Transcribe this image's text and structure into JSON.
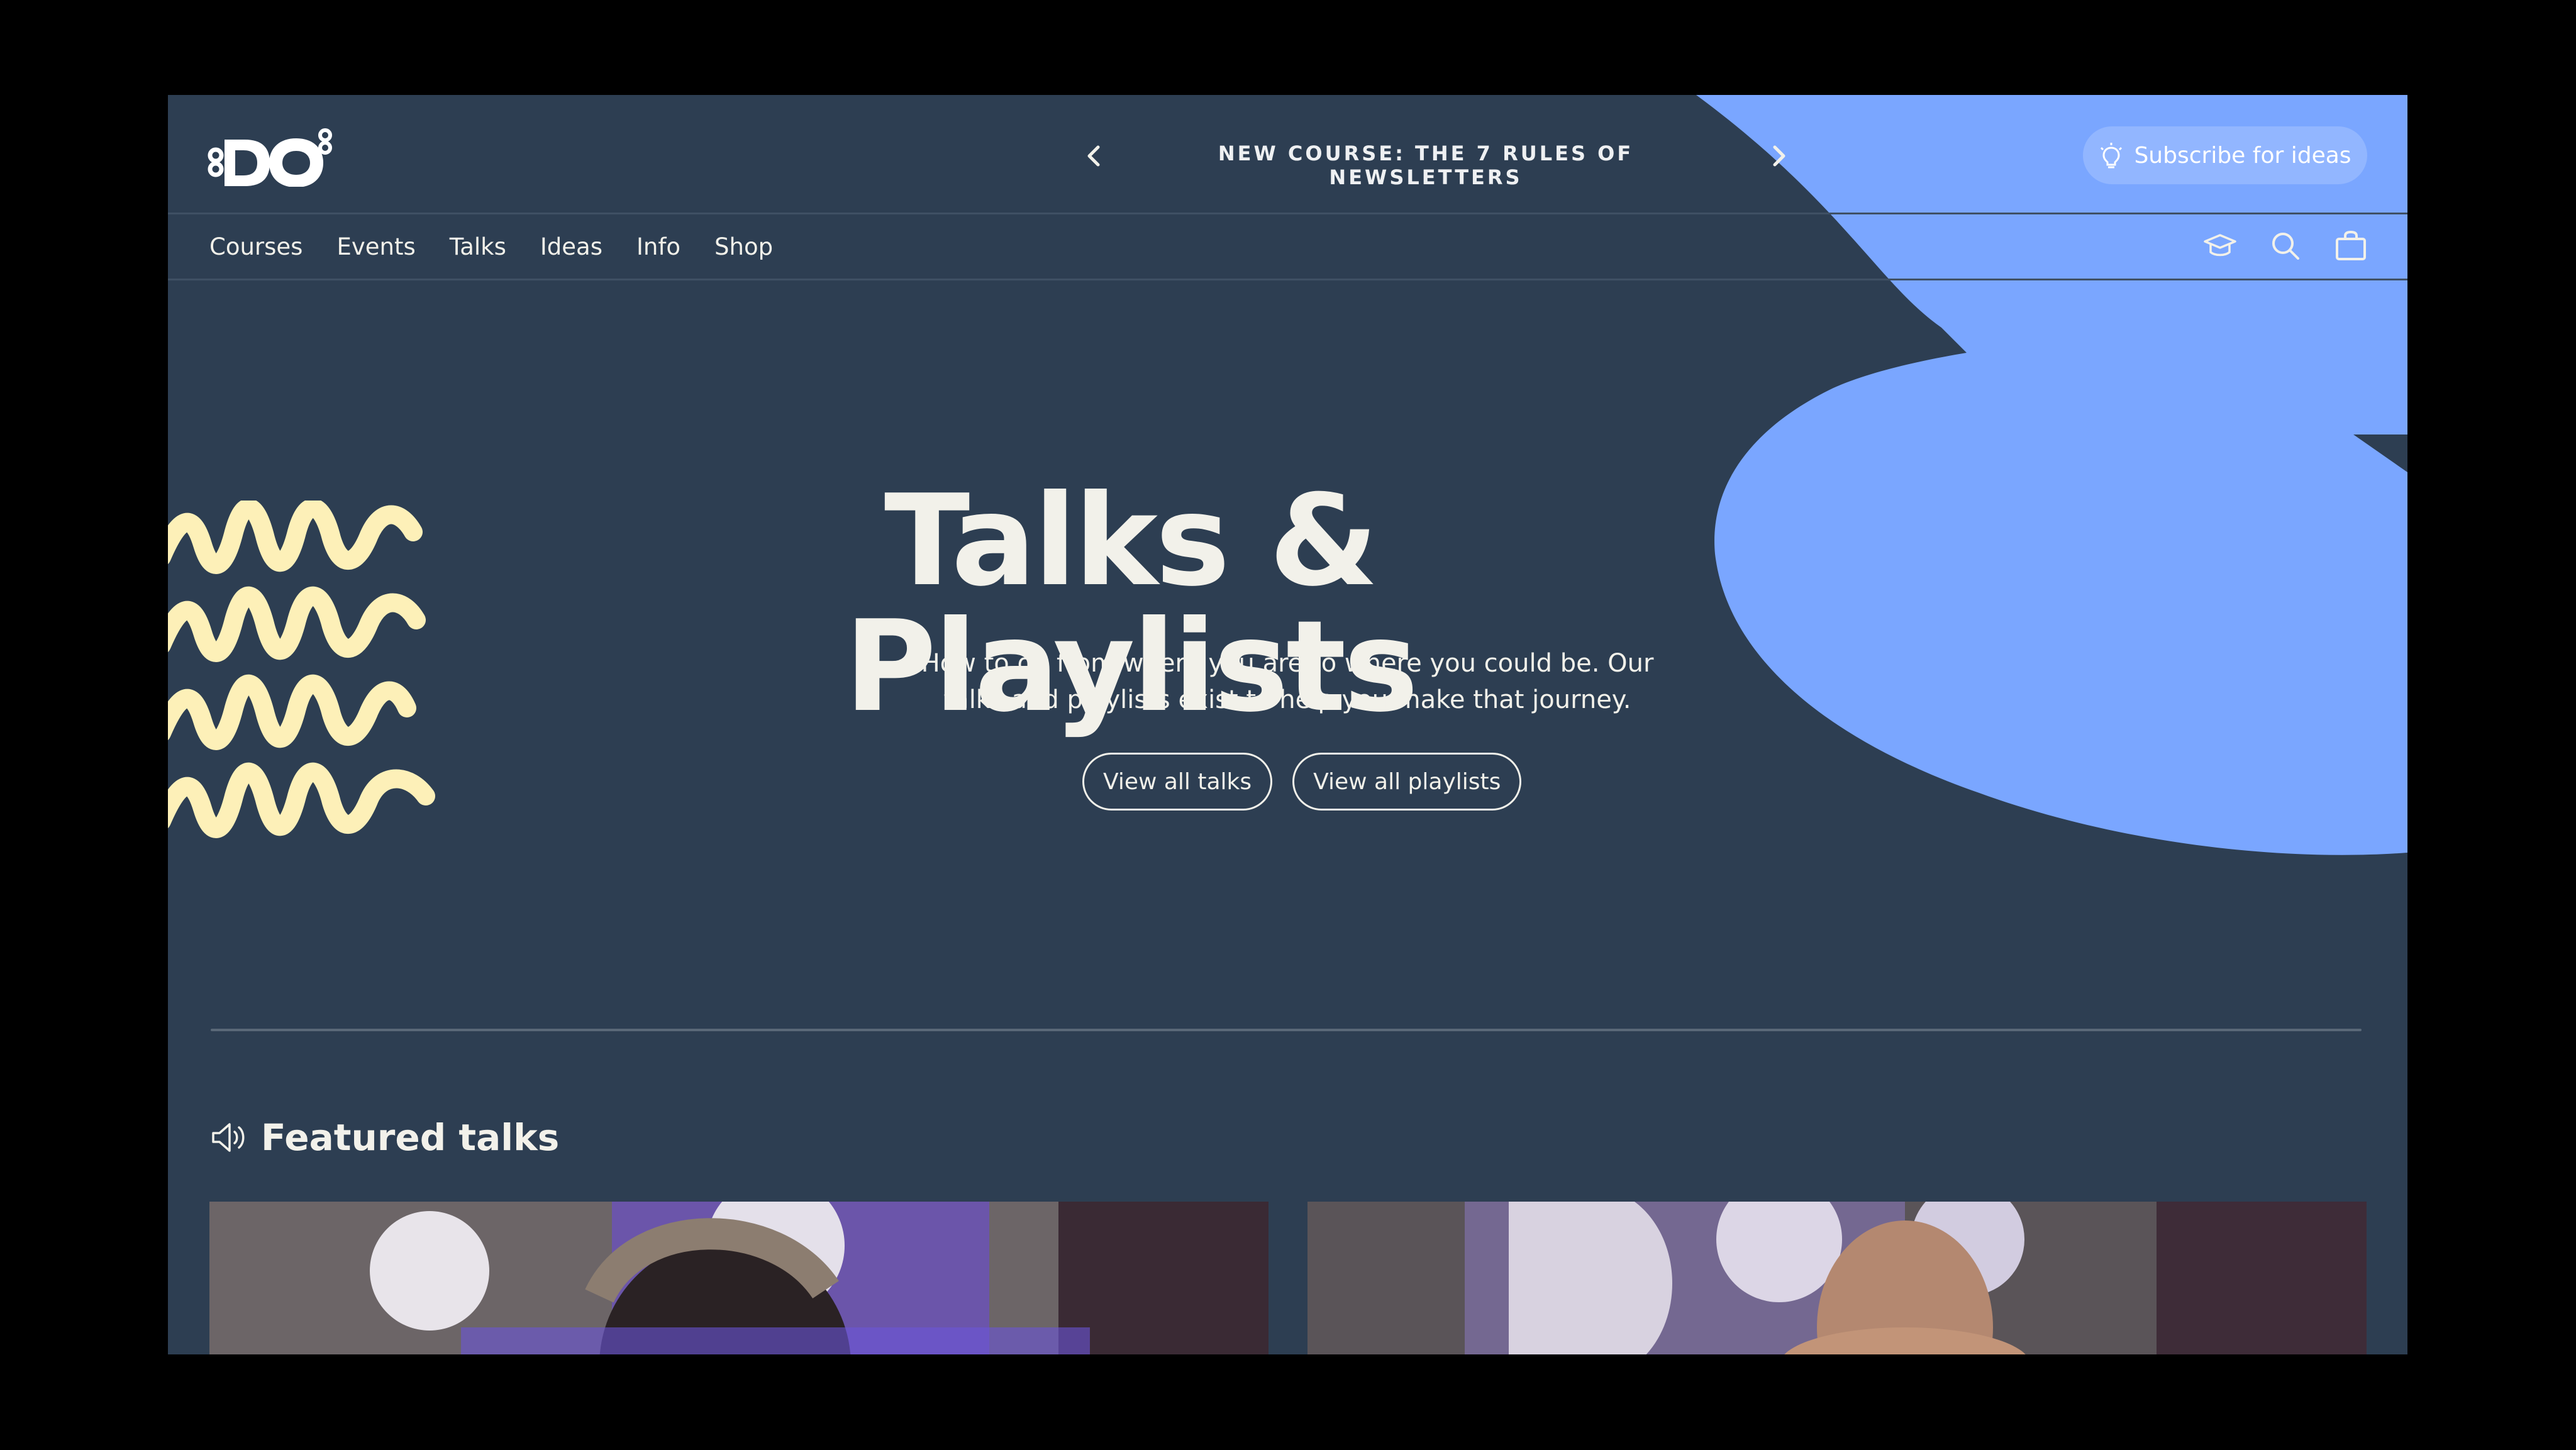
{
  "announcement": {
    "text": "NEW COURSE: THE 7 RULES OF NEWSLETTERS"
  },
  "header": {
    "logo_text": "DO",
    "subscribe_label": "Subscribe for ideas"
  },
  "nav": {
    "items": [
      "Courses",
      "Events",
      "Talks",
      "Ideas",
      "Info",
      "Shop"
    ],
    "icons": [
      "graduation-cap-icon",
      "search-icon",
      "shopping-bag-icon"
    ]
  },
  "hero": {
    "title": "Talks & Playlists",
    "subtitle_line1": "How to go from where you are to where you could be. Our",
    "subtitle_line2": "talks and playlists exist to help you make that journey.",
    "button_talks": "View all talks",
    "button_playlists": "View all playlists"
  },
  "featured": {
    "title": "Featured talks"
  },
  "colors": {
    "background": "#2d3e52",
    "accent_blue": "#7aa6ff",
    "squiggle_yellow": "#fdf0b8",
    "text": "#f2f1ea"
  }
}
